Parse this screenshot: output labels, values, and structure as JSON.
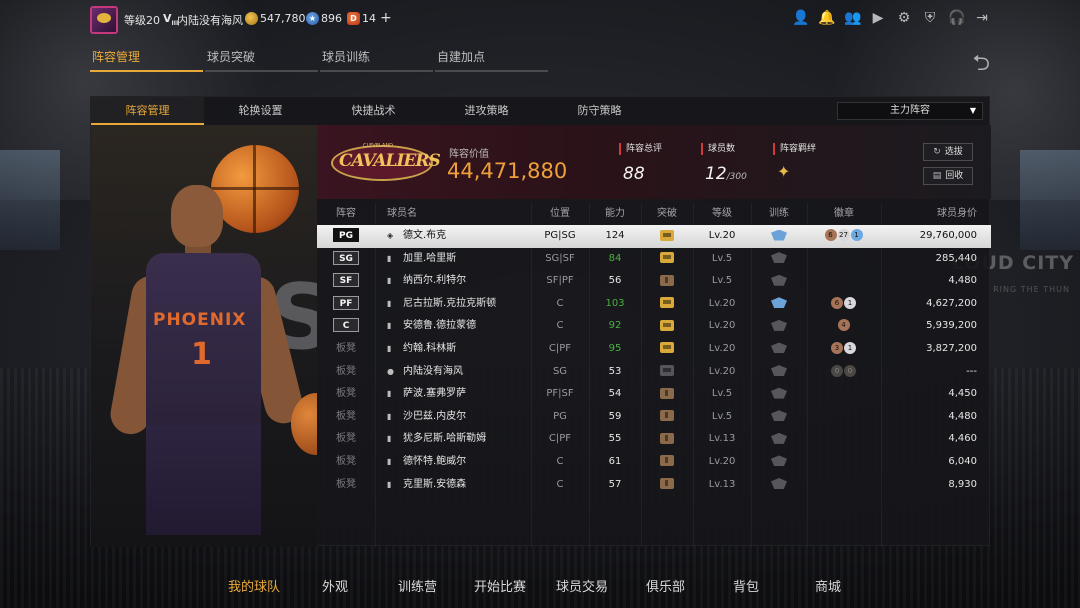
{
  "user": {
    "level": "等级20",
    "rank_glyph": "V",
    "rank_sub": "III",
    "name": "内陆没有海风",
    "gold": "547,780",
    "points": "896",
    "diamonds": "14",
    "plus": "+"
  },
  "top_icons": [
    "person-icon",
    "bell-icon",
    "friends-icon",
    "video-icon",
    "gear-icon",
    "shield-icon",
    "headset-icon",
    "exit-icon"
  ],
  "main_tabs": [
    "阵容管理",
    "球员突破",
    "球员训练",
    "自建加点"
  ],
  "sub_tabs": [
    "阵容管理",
    "轮换设置",
    "快捷战术",
    "进攻策略",
    "防守策略"
  ],
  "lineup_select": "主力阵容",
  "player_art": {
    "jersey_name": "PHOENIX",
    "jersey_number": "1"
  },
  "team": {
    "logo_text": "CAVALIERS",
    "logo_sub": "CLEVELAND",
    "value_label": "阵容价值",
    "value": "44,471,880",
    "rating_label": "阵容总评",
    "rating": "88",
    "players_label": "球员数",
    "players": "12",
    "players_max": "/300",
    "bond_label": "阵容羁绊",
    "select_btn": "选拔",
    "recycle_btn": "回收"
  },
  "columns": [
    "阵容",
    "球员名",
    "位置",
    "能力",
    "突破",
    "等级",
    "训练",
    "徽章",
    "球员身价"
  ],
  "rows": [
    {
      "slot": "PG",
      "starter": true,
      "name": "德文.布克",
      "pos": "PG|SG",
      "power": "124",
      "green": false,
      "brk": "gold",
      "lv": "Lv.20",
      "train": "blue",
      "badges": [
        [
          "br",
          "6"
        ],
        [
          "sv",
          "27"
        ],
        [
          "bl",
          "1"
        ]
      ],
      "value": "29,760,000"
    },
    {
      "slot": "SG",
      "starter": true,
      "name": "加里.哈里斯",
      "pos": "SG|SF",
      "power": "84",
      "green": true,
      "brk": "gold",
      "lv": "Lv.5",
      "train": "gray",
      "badges": [],
      "value": "285,440"
    },
    {
      "slot": "SF",
      "starter": true,
      "name": "纳西尔.利特尔",
      "pos": "SF|PF",
      "power": "56",
      "green": false,
      "brk": "dim",
      "lv": "Lv.5",
      "train": "gray",
      "badges": [],
      "value": "4,480"
    },
    {
      "slot": "PF",
      "starter": true,
      "name": "尼古拉斯.克拉克斯顿",
      "pos": "C",
      "power": "103",
      "green": true,
      "brk": "gold",
      "lv": "Lv.20",
      "train": "blue",
      "badges": [
        [
          "br",
          "6"
        ],
        [
          "sv",
          "1"
        ]
      ],
      "value": "4,627,200"
    },
    {
      "slot": "C",
      "starter": true,
      "name": "安德鲁.德拉蒙德",
      "pos": "C",
      "power": "92",
      "green": true,
      "brk": "gold",
      "lv": "Lv.20",
      "train": "gray",
      "badges": [
        [
          "br",
          "4"
        ]
      ],
      "value": "5,939,200"
    },
    {
      "slot": "板凳",
      "starter": false,
      "name": "约翰.科林斯",
      "pos": "C|PF",
      "power": "95",
      "green": true,
      "brk": "gold",
      "lv": "Lv.20",
      "train": "gray",
      "badges": [
        [
          "br",
          "3"
        ],
        [
          "sv",
          "1"
        ]
      ],
      "value": "3,827,200"
    },
    {
      "slot": "板凳",
      "starter": false,
      "name": "内陆没有海风",
      "pos": "SG",
      "power": "53",
      "green": false,
      "brk": "gray",
      "lv": "Lv.20",
      "train": "gray",
      "badges": [
        [
          "dk",
          "0"
        ],
        [
          "dk",
          "0"
        ]
      ],
      "value": "---"
    },
    {
      "slot": "板凳",
      "starter": false,
      "name": "萨波.塞弗罗萨",
      "pos": "PF|SF",
      "power": "54",
      "green": false,
      "brk": "dim",
      "lv": "Lv.5",
      "train": "gray",
      "badges": [],
      "value": "4,450"
    },
    {
      "slot": "板凳",
      "starter": false,
      "name": "沙巴兹.内皮尔",
      "pos": "PG",
      "power": "59",
      "green": false,
      "brk": "dim",
      "lv": "Lv.5",
      "train": "gray",
      "badges": [],
      "value": "4,480"
    },
    {
      "slot": "板凳",
      "starter": false,
      "name": "犹多尼斯.哈斯勒姆",
      "pos": "C|PF",
      "power": "55",
      "green": false,
      "brk": "dim",
      "lv": "Lv.13",
      "train": "gray",
      "badges": [],
      "value": "4,460"
    },
    {
      "slot": "板凳",
      "starter": false,
      "name": "德怀特.鲍威尔",
      "pos": "C",
      "power": "61",
      "green": false,
      "brk": "dim",
      "lv": "Lv.20",
      "train": "gray",
      "badges": [],
      "value": "6,040"
    },
    {
      "slot": "板凳",
      "starter": false,
      "name": "克里斯.安德森",
      "pos": "C",
      "power": "57",
      "green": false,
      "brk": "dim",
      "lv": "Lv.13",
      "train": "gray",
      "badges": [],
      "value": "8,930"
    }
  ],
  "bottom_nav": [
    "我的球队",
    "外观",
    "训练营",
    "开始比赛",
    "球员交易",
    "俱乐部",
    "背包",
    "商城"
  ],
  "background": {
    "city_text": "LOUD CITY",
    "city_sub": "RING THE THUN"
  },
  "colors": {
    "accent": "#e8a93a",
    "power_green": "#49b040",
    "stat_mark": "#d23a3a"
  }
}
